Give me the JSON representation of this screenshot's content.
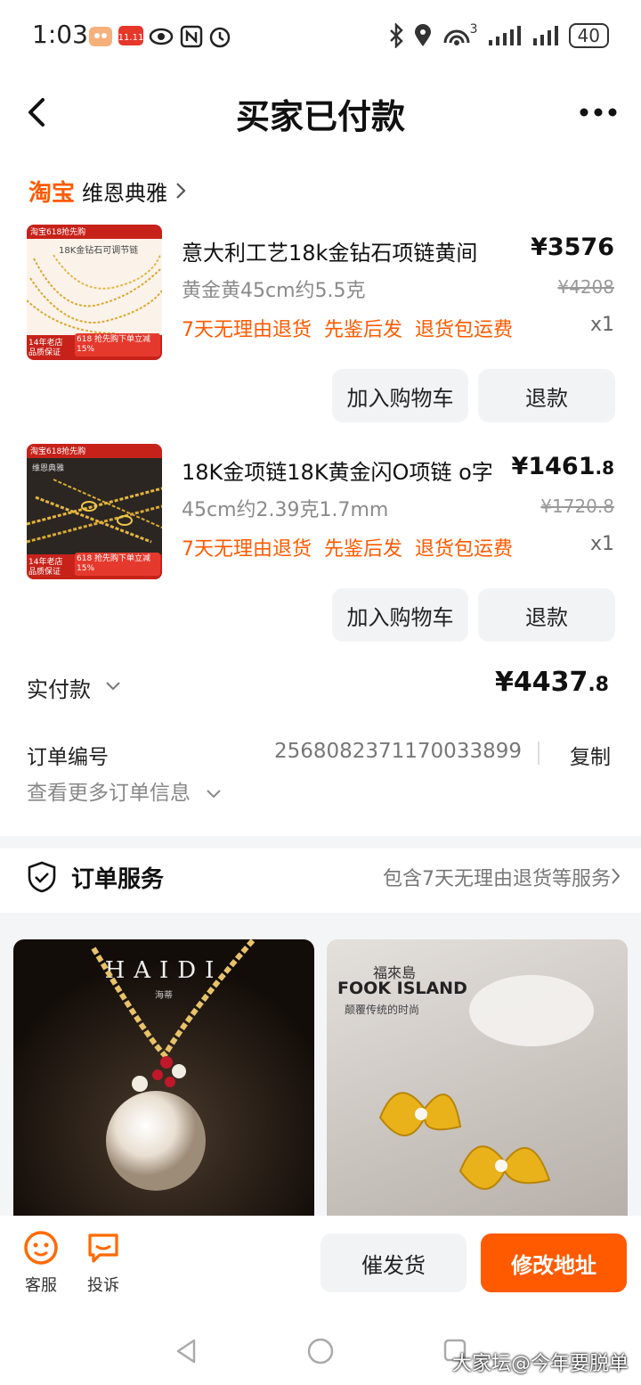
{
  "status_bar": {
    "time": "1:03",
    "battery": "40",
    "signal_label": "3"
  },
  "header": {
    "title": "买家已付款"
  },
  "shop": {
    "platform": "淘宝",
    "name": "维恩典雅"
  },
  "items": [
    {
      "title": "意大利工艺18k金钻石项链黄间",
      "price_main": "¥3576",
      "price_decimal": "",
      "spec": "黄金黄45cm约5.5克",
      "original_price": "¥4208",
      "tags": [
        "7天无理由退货",
        "先鉴后发",
        "退货包运费"
      ],
      "qty": "x1",
      "btn_cart": "加入购物车",
      "btn_refund": "退款",
      "thumb_banner": "淘宝618抢先购",
      "thumb_caption": "18K金钻石可调节链",
      "thumb_badge": "14年老店 品质保证",
      "thumb_promo": "618 抢先购下单立减 15%"
    },
    {
      "title": "18K金项链18K黄金闪O项链 o字",
      "price_main": "¥1461",
      "price_decimal": ".8",
      "spec": "45cm约2.39克1.7mm",
      "original_price": "¥1720.8",
      "tags": [
        "7天无理由退货",
        "先鉴后发",
        "退货包运费"
      ],
      "qty": "x1",
      "btn_cart": "加入购物车",
      "btn_refund": "退款",
      "thumb_banner": "淘宝618抢先购",
      "thumb_caption": "维恩典雅",
      "thumb_badge": "14年老店 品质保证",
      "thumb_promo": "618 抢先购下单立减 15%"
    }
  ],
  "payment": {
    "label": "实付款",
    "amount_main": "¥4437",
    "amount_decimal": ".8"
  },
  "order": {
    "label": "订单编号",
    "number": "2568082371170033899",
    "copy": "复制",
    "more": "查看更多订单信息"
  },
  "service": {
    "title": "订单服务",
    "desc": "包含7天无理由退货等服务"
  },
  "feed": [
    {
      "brand": "HAIDI",
      "brand_sub": "海蒂"
    },
    {
      "brand": "FOOK ISLAND",
      "brand_cn": "福來島",
      "slogan": "颠覆传统的时尚"
    }
  ],
  "bottom_bar": {
    "cs": "客服",
    "complain": "投诉",
    "urge": "催发货",
    "modify": "修改地址"
  },
  "watermark": "大家坛@今年要脱单",
  "colors": {
    "accent": "#ff5a00",
    "muted": "#8a8a8a",
    "button_bg": "#f2f3f5"
  }
}
